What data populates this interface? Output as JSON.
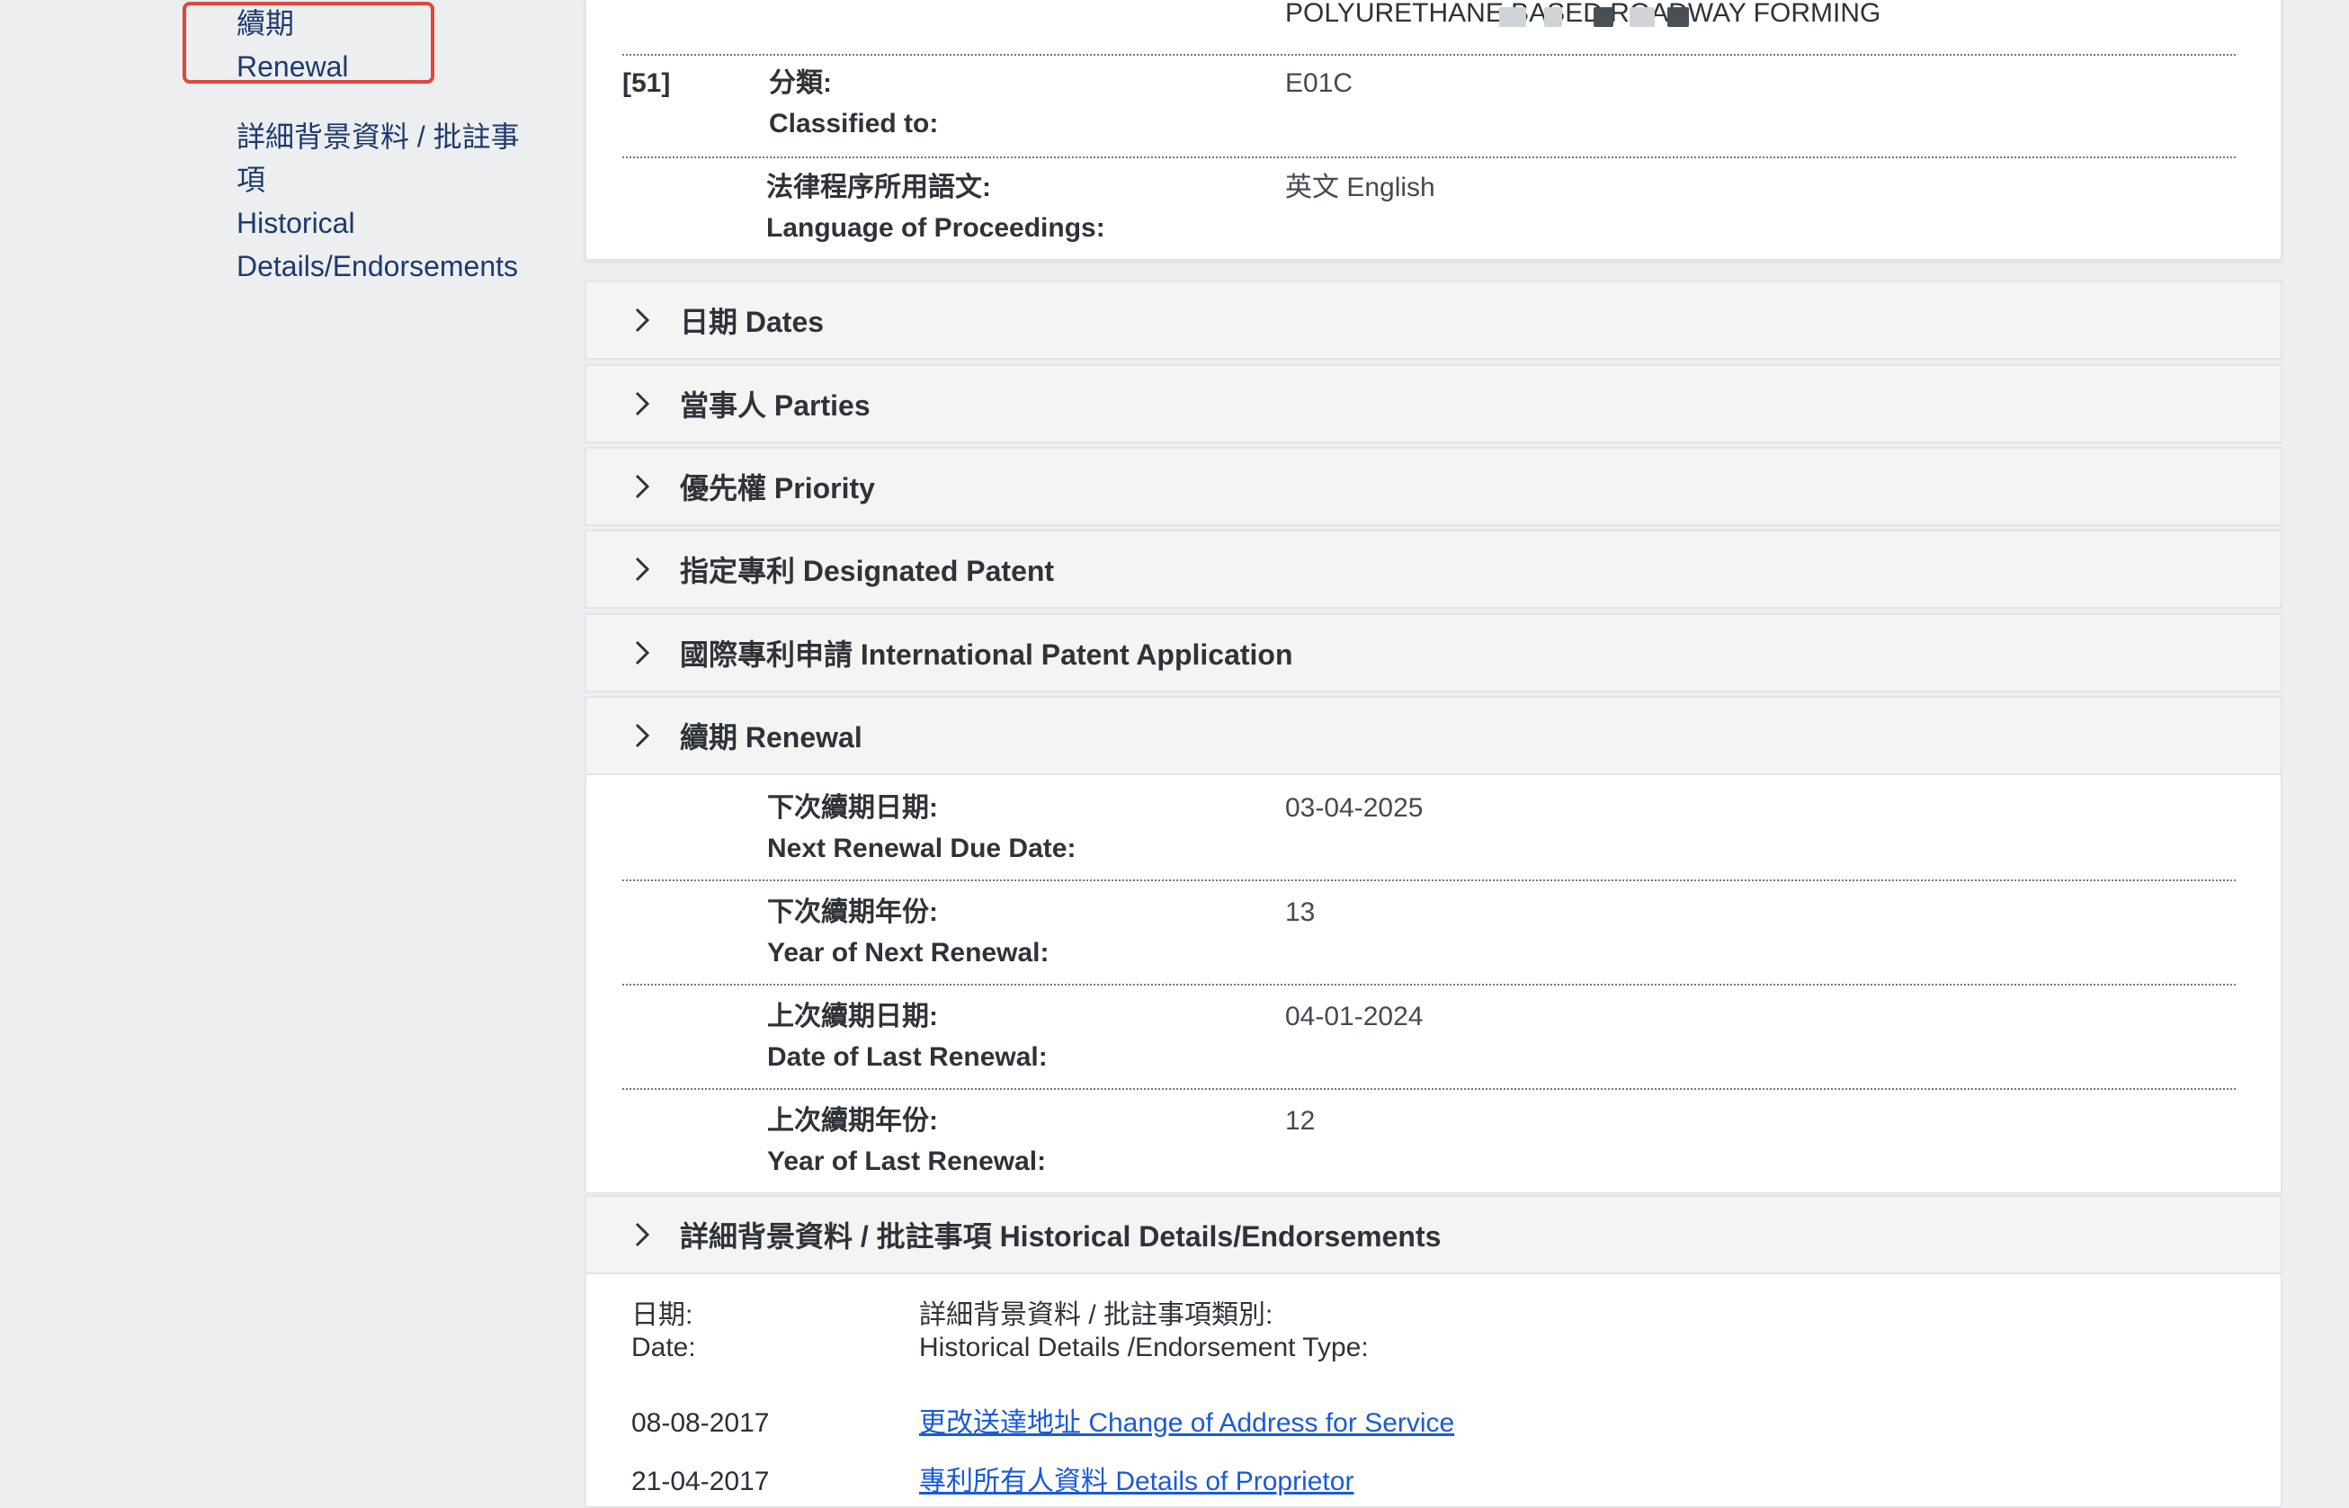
{
  "sidebar": {
    "items": [
      {
        "zh": "續期",
        "en": "Renewal",
        "highlighted": true
      },
      {
        "zh_line1": "詳細背景資料 / 批註事",
        "zh_line2": "項",
        "en_line1": "Historical",
        "en_line2": "Details/Endorsements"
      }
    ]
  },
  "colors": {
    "highlight_border": "#e0473a",
    "link": "#1a5ad8",
    "nav_link": "#1e3a6e"
  },
  "top_card": {
    "title_fragment": "POLYURETHANE BASED ROADWAY FORMING",
    "rows": [
      {
        "code": "[51]",
        "label_zh": "分類:",
        "label_en": "Classified to:",
        "value": "E01C"
      },
      {
        "code": "",
        "label_zh": "法律程序所用語文:",
        "label_en": "Language of Proceedings:",
        "value": "英文 English"
      }
    ]
  },
  "accordions": [
    {
      "title": "日期 Dates",
      "expanded": false
    },
    {
      "title": "當事人 Parties",
      "expanded": false
    },
    {
      "title": "優先權 Priority",
      "expanded": false
    },
    {
      "title": "指定專利 Designated Patent",
      "expanded": false
    },
    {
      "title": "國際專利申請 International Patent Application",
      "expanded": false
    },
    {
      "title": "續期 Renewal",
      "expanded": true
    },
    {
      "title": "詳細背景資料 / 批註事項 Historical Details/Endorsements",
      "expanded": true
    }
  ],
  "renewal": {
    "rows": [
      {
        "label_zh": "下次續期日期:",
        "label_en": "Next Renewal Due Date:",
        "value": "03-04-2025"
      },
      {
        "label_zh": "下次續期年份:",
        "label_en": "Year of Next Renewal:",
        "value": "13"
      },
      {
        "label_zh": "上次續期日期:",
        "label_en": "Date of Last Renewal:",
        "value": "04-01-2024"
      },
      {
        "label_zh": "上次續期年份:",
        "label_en": "Year of Last Renewal:",
        "value": "12"
      }
    ]
  },
  "history": {
    "col_date_zh": "日期:",
    "col_date_en": "Date:",
    "col_type_zh": "詳細背景資料 / 批註事項類別:",
    "col_type_en": "Historical Details /Endorsement Type:",
    "entries": [
      {
        "date": "08-08-2017",
        "type": "更改送達地址 Change of Address for Service"
      },
      {
        "date": "21-04-2017",
        "type": "專利所有人資料 Details of Proprietor"
      }
    ]
  }
}
